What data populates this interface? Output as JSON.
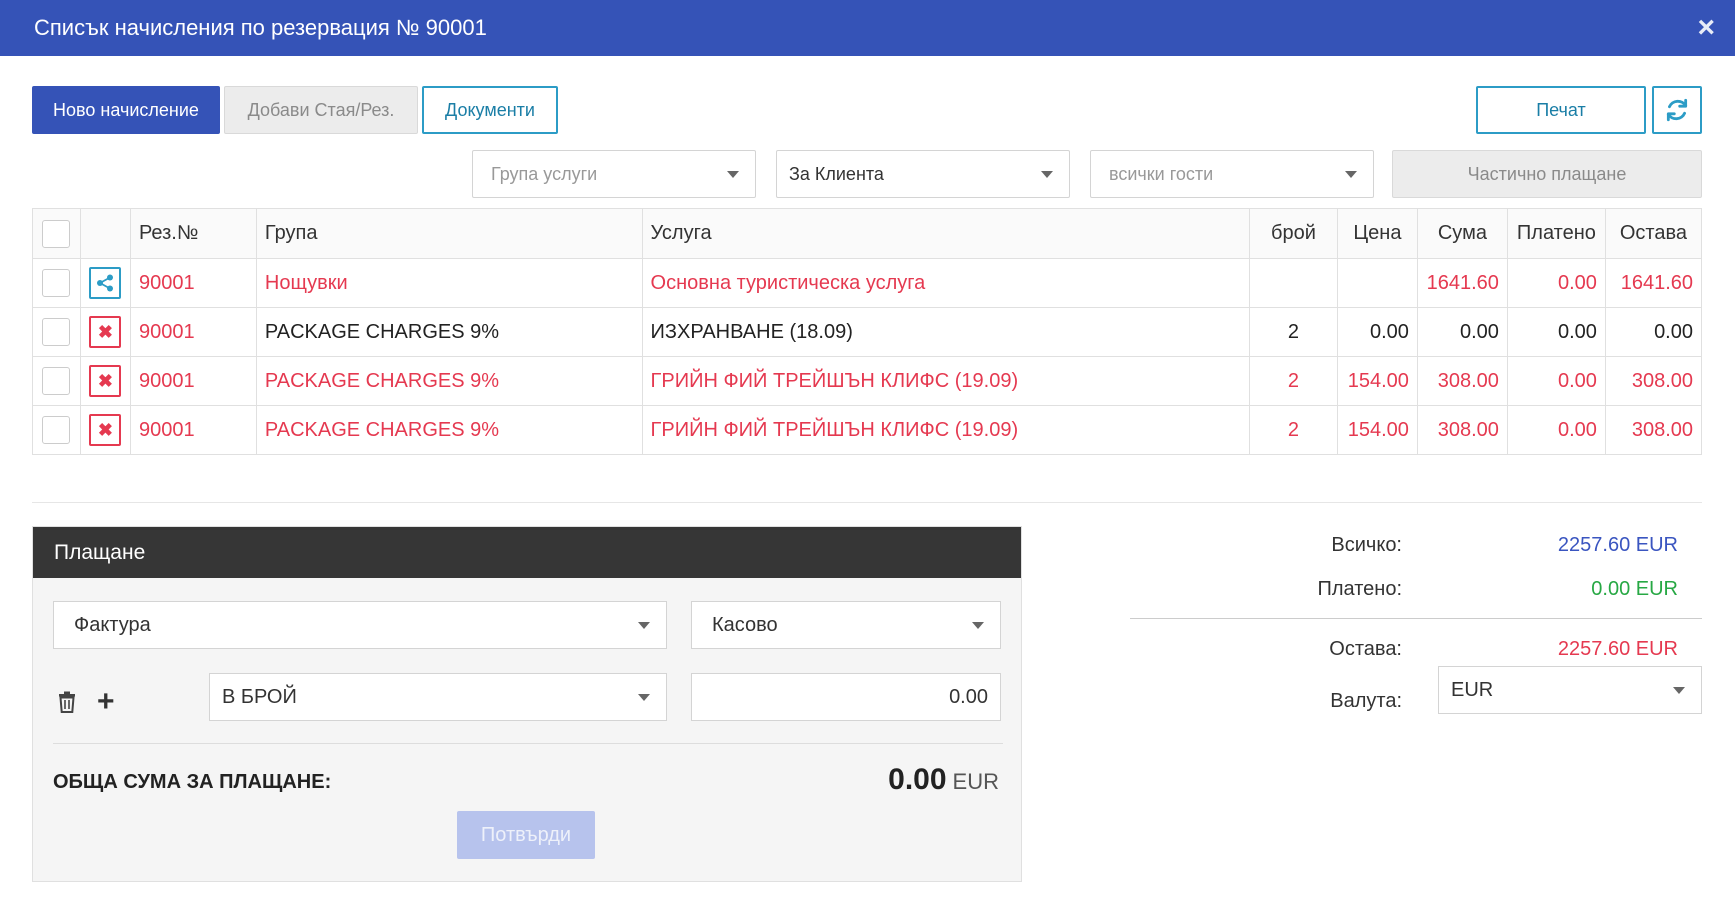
{
  "window": {
    "title": "Списък начисления по резервация № 90001",
    "close": "×"
  },
  "toolbar": {
    "new_charge": "Ново начисление",
    "add_room": "Добави Стая/Рез.",
    "documents": "Документи",
    "print": "Печат",
    "refresh_icon": "refresh-icon"
  },
  "filters": {
    "service_group": "Група услуги",
    "client": "За Клиента",
    "guests": "всички гости",
    "partial_payment": "Частично плащане"
  },
  "table": {
    "headers": [
      "Рез.№",
      "Група",
      "Услуга",
      "брой",
      "Цена",
      "Сума",
      "Платено",
      "Остава"
    ],
    "rows": [
      {
        "action": "share",
        "res": "90001",
        "group": "Нощувки",
        "service": "Основна туристическа услуга",
        "qty": "",
        "price": "",
        "sum": "1641.60",
        "paid": "0.00",
        "remain": "1641.60",
        "highlight": true
      },
      {
        "action": "delete",
        "res": "90001",
        "group": "PACKAGE CHARGES 9%",
        "service": "ИЗХРАНВАНЕ (18.09)",
        "qty": "2",
        "price": "0.00",
        "sum": "0.00",
        "paid": "0.00",
        "remain": "0.00",
        "highlight": false
      },
      {
        "action": "delete",
        "res": "90001",
        "group": "PACKAGE CHARGES 9%",
        "service": "ГРИЙН ФИЙ ТРЕЙШЪН КЛИФС (19.09)",
        "qty": "2",
        "price": "154.00",
        "sum": "308.00",
        "paid": "0.00",
        "remain": "308.00",
        "highlight": true
      },
      {
        "action": "delete",
        "res": "90001",
        "group": "PACKAGE CHARGES 9%",
        "service": "ГРИЙН ФИЙ ТРЕЙШЪН КЛИФС (19.09)",
        "qty": "2",
        "price": "154.00",
        "sum": "308.00",
        "paid": "0.00",
        "remain": "308.00",
        "highlight": true
      }
    ]
  },
  "payment": {
    "header": "Плащане",
    "doc_type": "Фактура",
    "method": "Касово",
    "pay_type": "В БРОЙ",
    "amount": "0.00",
    "total_label": "ОБЩА СУМА ЗА ПЛАЩАНЕ:",
    "total_value": "0.00",
    "total_currency": "EUR",
    "confirm": "Потвърди"
  },
  "summary": {
    "total_label": "Всичко:",
    "total_value": "2257.60 EUR",
    "paid_label": "Платено:",
    "paid_value": "0.00 EUR",
    "remain_label": "Остава:",
    "remain_value": "2257.60 EUR",
    "currency_label": "Валута:",
    "currency_value": "EUR"
  },
  "colors": {
    "title_bar": "#3553b7",
    "primary": "#3553b7",
    "outline": "#2c9cc6",
    "highlight_red": "#e53950",
    "total_blue": "#3a55c0",
    "paid_green": "#27a844",
    "remain_red": "#e53950",
    "payment_header": "#363636"
  }
}
